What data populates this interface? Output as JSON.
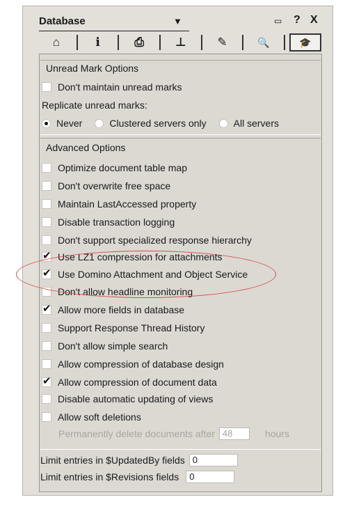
{
  "window": {
    "title": "Database",
    "dropdown_glyph": "▼",
    "controls": [
      "▭",
      "?",
      "X"
    ]
  },
  "tabs": [
    {
      "icon": "basics-tab-icon",
      "glyph": "⌂"
    },
    {
      "icon": "info-tab-icon",
      "glyph": "i"
    },
    {
      "icon": "print-tab-icon",
      "glyph": "⎙"
    },
    {
      "icon": "design-tab-icon",
      "glyph": "⊥"
    },
    {
      "icon": "launch-tab-icon",
      "glyph": "✎"
    },
    {
      "icon": "search-tab-icon",
      "glyph": "🔍"
    },
    {
      "icon": "advanced-tab-icon",
      "glyph": "🎓"
    }
  ],
  "unread": {
    "header": "Unread Mark Options",
    "dont_maintain": {
      "label": "Don't maintain unread marks",
      "checked": false
    },
    "replicate_label": "Replicate unread marks:",
    "radios": [
      {
        "label": "Never",
        "selected": true
      },
      {
        "label": "Clustered servers only",
        "selected": false
      },
      {
        "label": "All servers",
        "selected": false
      }
    ]
  },
  "advanced": {
    "header": "Advanced Options",
    "options": [
      {
        "label": "Optimize document table map",
        "checked": false
      },
      {
        "label": "Don't overwrite free space",
        "checked": false
      },
      {
        "label": "Maintain LastAccessed property",
        "checked": false
      },
      {
        "label": "Disable transaction logging",
        "checked": false
      },
      {
        "label": "Don't support specialized response hierarchy",
        "checked": false
      },
      {
        "label": "Use LZ1 compression for attachments",
        "checked": true
      },
      {
        "label": "Use Domino Attachment and Object Service",
        "checked": true
      },
      {
        "label": "Don't allow headline monitoring",
        "checked": false
      },
      {
        "label": "Allow more fields in database",
        "checked": true
      },
      {
        "label": "Support Response Thread History",
        "checked": false
      },
      {
        "label": "Don't allow simple search",
        "checked": false
      },
      {
        "label": "Allow compression of database design",
        "checked": false
      },
      {
        "label": "Allow compression of document data",
        "checked": true
      },
      {
        "label": "Disable automatic updating of views",
        "checked": false
      },
      {
        "label": "Allow soft deletions",
        "checked": false
      }
    ],
    "delete_after_label": "Permanently delete documents after",
    "delete_after_value": "48",
    "delete_after_unit": "hours",
    "limit_updatedby_label": "Limit entries in $UpdatedBy fields",
    "limit_updatedby_value": "0",
    "limit_revisions_label": "Limit entries in $Revisions fields",
    "limit_revisions_value": "0"
  },
  "annotation_color": "#d24a4a"
}
